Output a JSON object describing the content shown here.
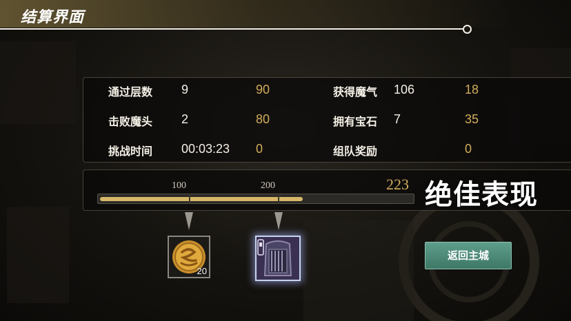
{
  "header": {
    "title": "结算界面"
  },
  "stats": {
    "floors": {
      "label": "通过层数",
      "value": "9",
      "score": "90"
    },
    "magic": {
      "label": "获得魔气",
      "value": "106",
      "score": "18"
    },
    "bosses": {
      "label": "击败魔头",
      "value": "2",
      "score": "80"
    },
    "gems": {
      "label": "拥有宝石",
      "value": "7",
      "score": "35"
    },
    "time": {
      "label": "挑战时间",
      "value": "00:03:23",
      "score": "0"
    },
    "team": {
      "label": "组队奖励",
      "value": "",
      "score": "0"
    }
  },
  "progress": {
    "milestones": [
      "100",
      "200"
    ],
    "total": "223",
    "rating": "绝佳表现",
    "fill_fraction": 0.65
  },
  "rewards": [
    {
      "icon": "gold-coin-icon",
      "count": "20"
    },
    {
      "icon": "armor-chest-icon",
      "count": ""
    }
  ],
  "actions": {
    "return_label": "返回主城"
  },
  "colors": {
    "accent_gold": "#d2ad5c",
    "button_teal": "#4f8c7a",
    "bar_fill": "#d8b868"
  }
}
